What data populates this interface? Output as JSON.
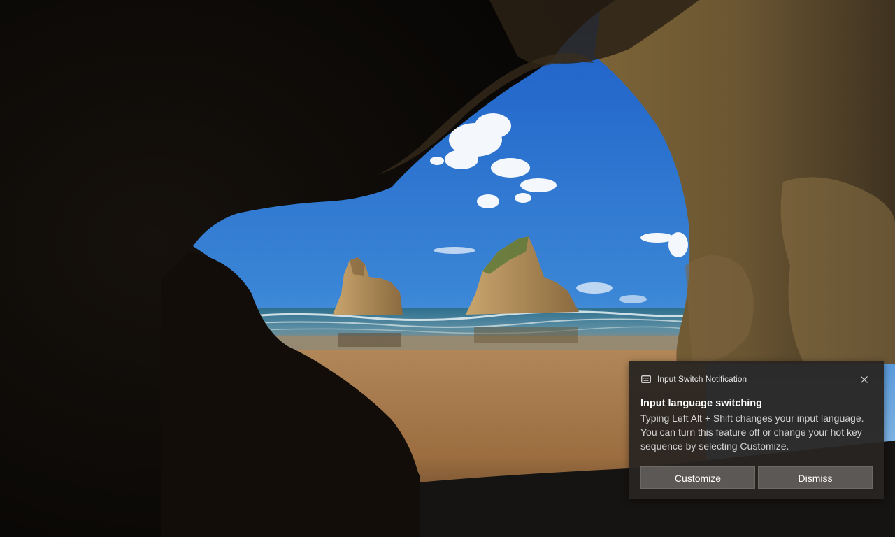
{
  "wallpaper": {
    "description_icon": "cave-beach-wallpaper",
    "colors": {
      "sky_top": "#1f63c9",
      "sky_bottom": "#8fbfe6",
      "sea": "#2a6b8c",
      "sand": "#a77a4c",
      "rock": "#6e5a3a",
      "cave": "#100c08"
    }
  },
  "notification": {
    "app_name": "Input Switch Notification",
    "app_icon": "keyboard-icon",
    "close_icon": "close-icon",
    "title": "Input language switching",
    "body": "Typing Left Alt + Shift changes your input language. You can turn this feature off or change your hot key sequence by selecting Customize.",
    "actions": {
      "customize_label": "Customize",
      "dismiss_label": "Dismiss"
    },
    "colors": {
      "background": "#282421",
      "button": "#5b5855"
    }
  }
}
